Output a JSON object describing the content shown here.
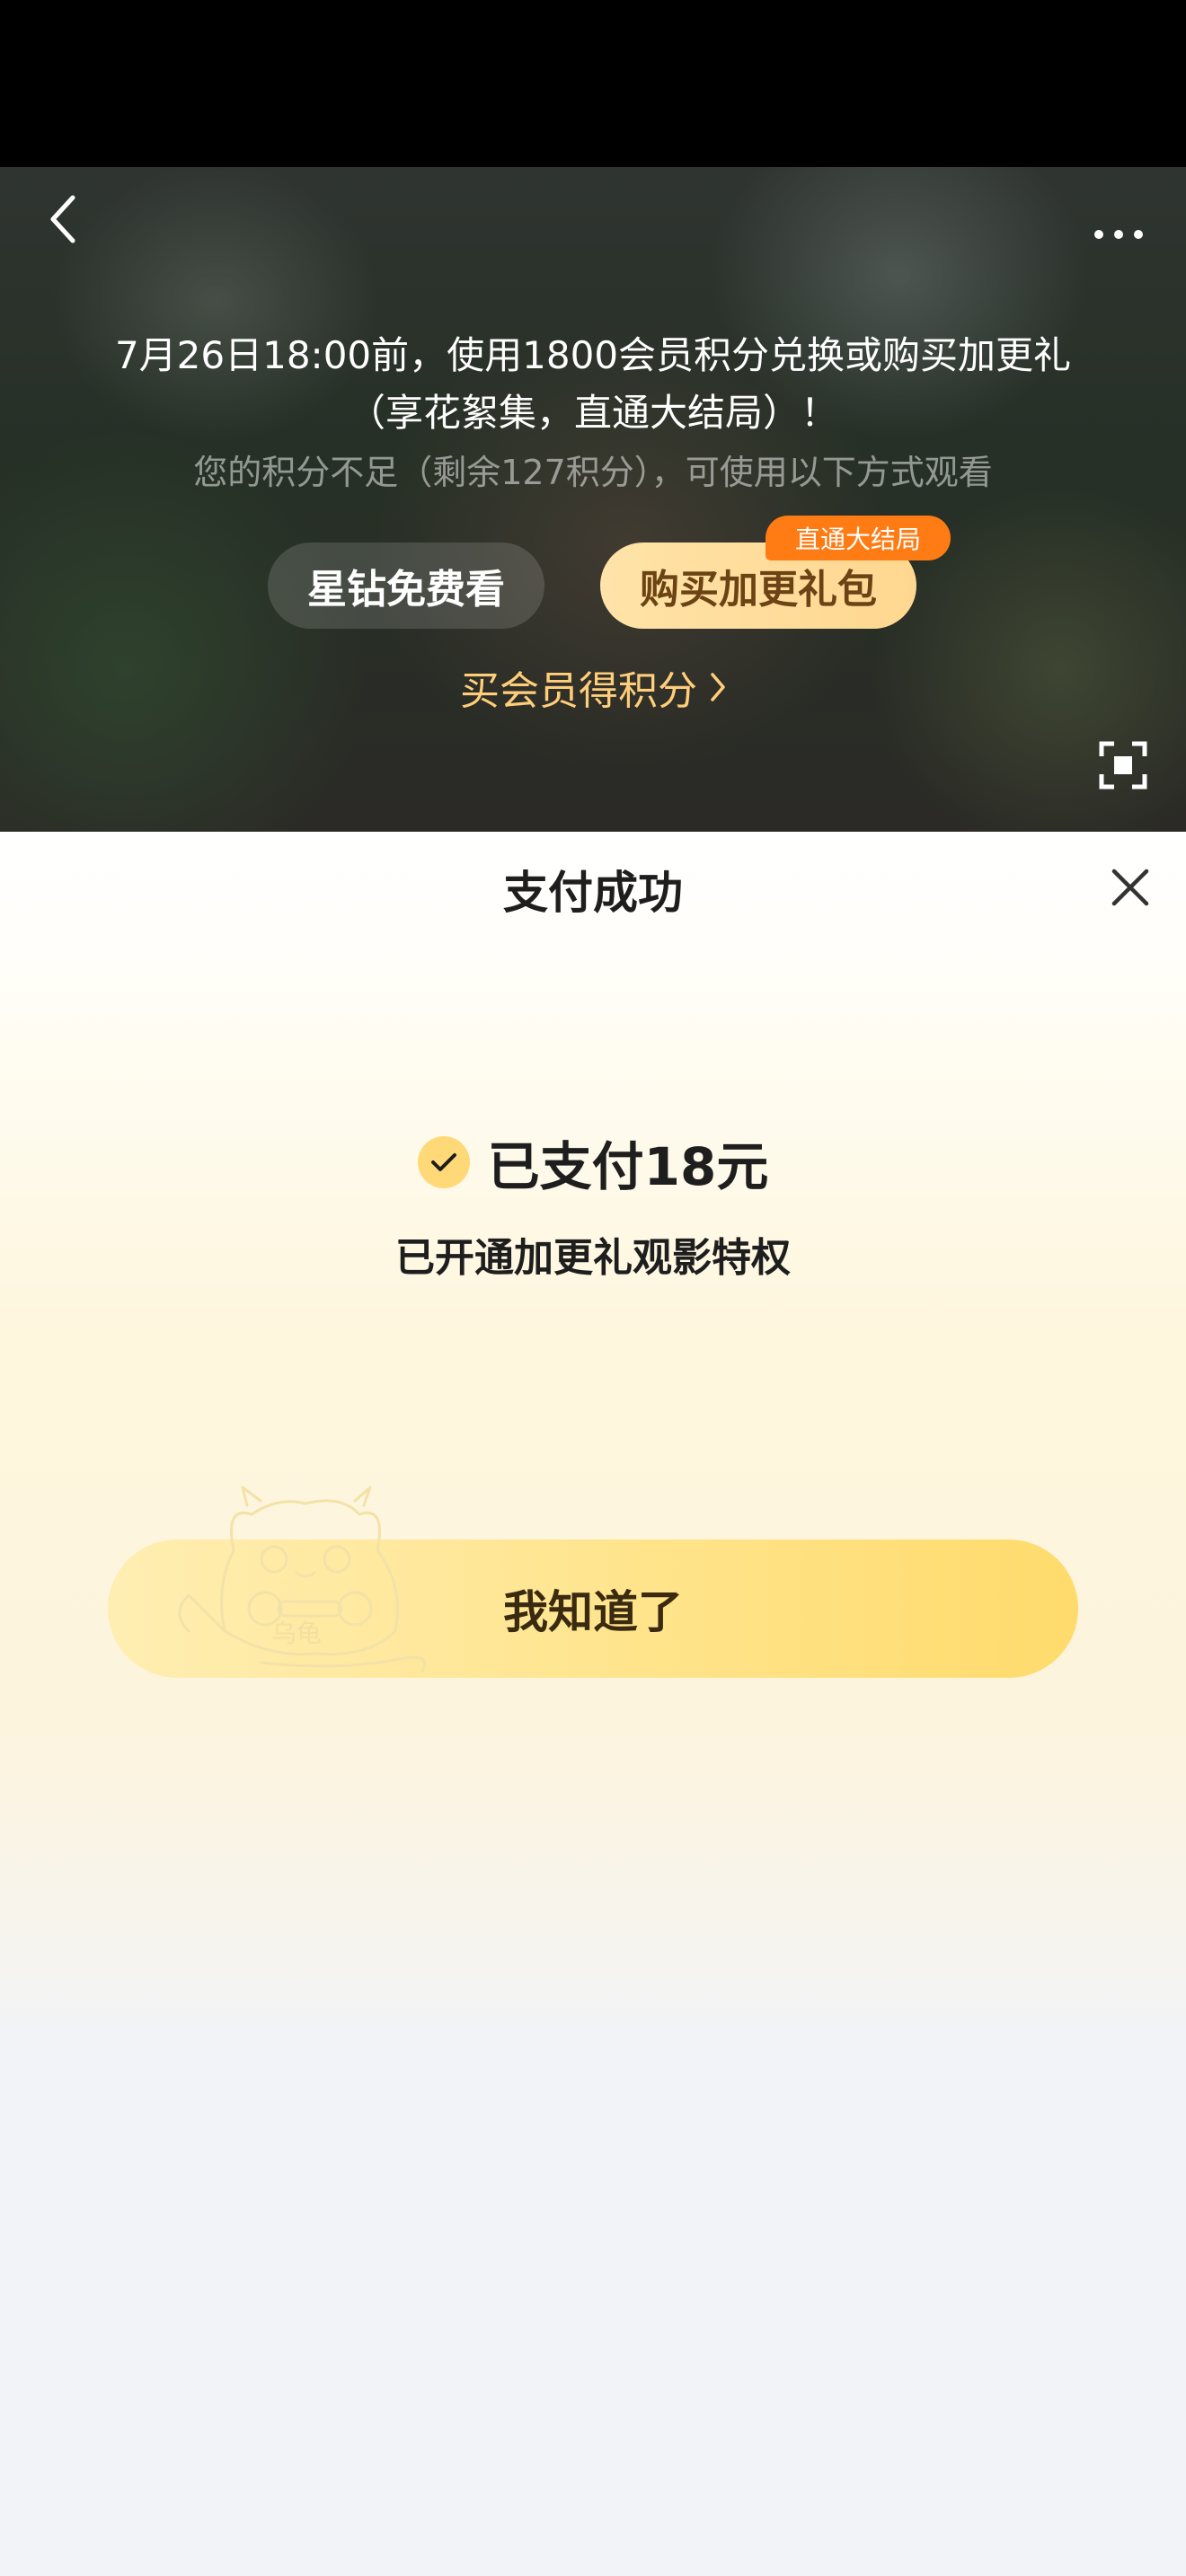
{
  "player": {
    "notice": "7月26日18:00前，使用1800会员积分兑换或购买加更礼（享花絮集，直通大结局）！",
    "points_hint": "您的积分不足（剩余127积分），可使用以下方式观看",
    "free_button": "星钻免费看",
    "buy_button": "购买加更礼包",
    "buy_badge": "直通大结局",
    "member_link": "买会员得积分"
  },
  "sheet": {
    "title": "支付成功",
    "paid": "已支付18元",
    "privilege": "已开通加更礼观影特权",
    "confirm_button": "我知道了",
    "mascot_text": "乌龟"
  },
  "icons": [
    "back-icon",
    "more-icon",
    "fullscreen-icon",
    "close-icon",
    "check-icon",
    "chevron-right-icon"
  ],
  "colors": {
    "accent_gold": "#ffd978",
    "badge_orange": "#ff7b14",
    "link_gold": "#ffce7a"
  }
}
